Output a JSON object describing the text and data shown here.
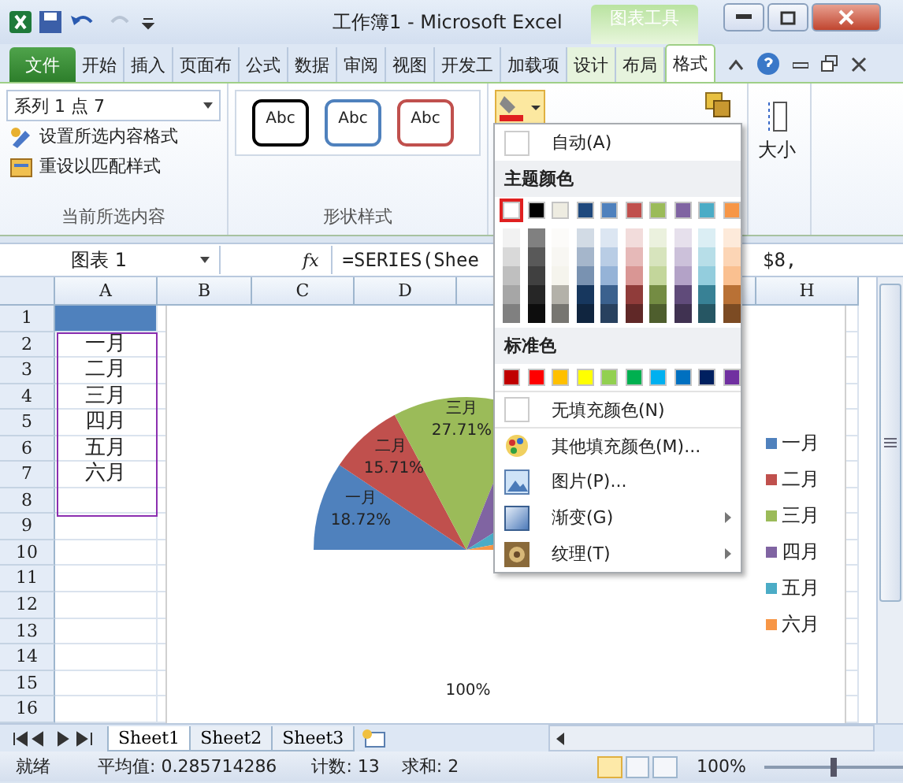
{
  "title_bar": {
    "title": "工作簿1 - Microsoft Excel",
    "context_label": "图表工具"
  },
  "tabs": [
    {
      "label": "文件",
      "kind": "file",
      "selected": false
    },
    {
      "label": "开始",
      "kind": "main",
      "selected": false
    },
    {
      "label": "插入",
      "kind": "main",
      "selected": false
    },
    {
      "label": "页面布",
      "kind": "main",
      "selected": false
    },
    {
      "label": "公式",
      "kind": "main",
      "selected": false
    },
    {
      "label": "数据",
      "kind": "main",
      "selected": false
    },
    {
      "label": "审阅",
      "kind": "main",
      "selected": false
    },
    {
      "label": "视图",
      "kind": "main",
      "selected": false
    },
    {
      "label": "开发工",
      "kind": "main",
      "selected": false
    },
    {
      "label": "加载项",
      "kind": "main",
      "selected": false
    },
    {
      "label": "设计",
      "kind": "context",
      "selected": false
    },
    {
      "label": "布局",
      "kind": "context",
      "selected": false
    },
    {
      "label": "格式",
      "kind": "context",
      "selected": true
    }
  ],
  "ribbon": {
    "selection_box": "系列 1 点 7",
    "format_selection": "设置所选内容格式",
    "reset_style": "重设以匹配样式",
    "current_group": "当前所选内容",
    "shape_styles": [
      {
        "label": "Abc",
        "color": "#000000"
      },
      {
        "label": "Abc",
        "color": "#4f81bd"
      },
      {
        "label": "Abc",
        "color": "#c0504d"
      }
    ],
    "shape_group": "形状样式",
    "size": "大小"
  },
  "formula_bar": {
    "name_box": "图表 1",
    "function_label": "fx",
    "formula_start": "=SERIES(Shee",
    "formula_end": "$8,"
  },
  "sheet": {
    "columns": [
      "A",
      "B",
      "C",
      "D",
      "H"
    ],
    "rows": [
      "1",
      "2",
      "3",
      "4",
      "5",
      "6",
      "7",
      "8",
      "9",
      "10",
      "11",
      "12",
      "13",
      "14",
      "15",
      "16"
    ],
    "column_a": [
      "一月",
      "二月",
      "三月",
      "四月",
      "五月",
      "六月"
    ]
  },
  "chart": {
    "slices": [
      {
        "label": "一月",
        "percent": "18.72%"
      },
      {
        "label": "二月",
        "percent": "15.71%"
      },
      {
        "label": "三月",
        "percent": "27.71%"
      }
    ],
    "legend": [
      {
        "label": "一月",
        "color": "#4f81bd"
      },
      {
        "label": "二月",
        "color": "#c0504d"
      },
      {
        "label": "三月",
        "color": "#9bbb59"
      },
      {
        "label": "四月",
        "color": "#8064a2"
      },
      {
        "label": "五月",
        "color": "#4bacc6"
      },
      {
        "label": "六月",
        "color": "#f79646"
      }
    ],
    "hidden_slice_label": "100%"
  },
  "color_menu": {
    "auto": "自动(A)",
    "theme_header": "主题颜色",
    "theme_colors": [
      {
        "color": "#ffffff",
        "selected": true
      },
      {
        "color": "#000000",
        "selected": false
      },
      {
        "color": "#eeece1",
        "selected": false
      },
      {
        "color": "#1f497d",
        "selected": false
      },
      {
        "color": "#4f81bd",
        "selected": false
      },
      {
        "color": "#c0504d",
        "selected": false
      },
      {
        "color": "#9bbb59",
        "selected": false
      },
      {
        "color": "#8064a2",
        "selected": false
      },
      {
        "color": "#4bacc6",
        "selected": false
      },
      {
        "color": "#f79646",
        "selected": false
      }
    ],
    "standard_header": "标准色",
    "standard_colors": [
      {
        "color": "#c00000"
      },
      {
        "color": "#ff0000"
      },
      {
        "color": "#ffc000"
      },
      {
        "color": "#ffff00"
      },
      {
        "color": "#92d050"
      },
      {
        "color": "#00b050"
      },
      {
        "color": "#00b0f0"
      },
      {
        "color": "#0070c0"
      },
      {
        "color": "#002060"
      },
      {
        "color": "#7030a0"
      }
    ],
    "items": [
      {
        "label": "无填充颜色(N)",
        "kind": "none",
        "submenu": false
      },
      {
        "label": "其他填充颜色(M)...",
        "kind": "palette",
        "submenu": false
      },
      {
        "label": "图片(P)...",
        "kind": "picture",
        "submenu": false
      },
      {
        "label": "渐变(G)",
        "kind": "gradient",
        "submenu": true
      },
      {
        "label": "纹理(T)",
        "kind": "texture",
        "submenu": true
      }
    ]
  },
  "sheet_tabs": [
    {
      "label": "Sheet1",
      "selected": true
    },
    {
      "label": "Sheet2",
      "selected": false
    },
    {
      "label": "Sheet3",
      "selected": false
    }
  ],
  "status_bar": {
    "ready": "就绪",
    "average": "平均值: 0.285714286",
    "count": "计数: 13",
    "sum": "求和: 2",
    "zoom": "100%",
    "zoom_slider": {
      "level": 0.5
    }
  }
}
